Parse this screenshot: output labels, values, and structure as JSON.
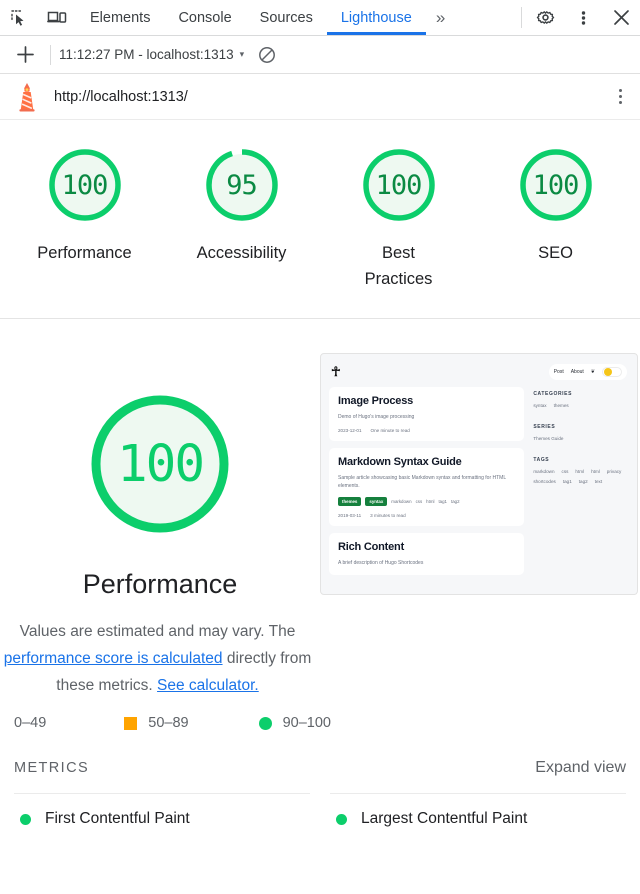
{
  "devtools": {
    "icons": {
      "inspect": "inspect-element-icon",
      "device": "device-toolbar-icon",
      "more_tabs": "»",
      "settings": "gear-icon",
      "menu": "kebab-menu-icon",
      "close": "close-icon"
    },
    "tabs": [
      {
        "label": "Elements",
        "active": false
      },
      {
        "label": "Console",
        "active": false
      },
      {
        "label": "Sources",
        "active": false
      },
      {
        "label": "Lighthouse",
        "active": true
      }
    ]
  },
  "runbar": {
    "new_report_label": "+",
    "selected_run": "11:12:27 PM - localhost:1313",
    "caret": "▾",
    "clear_label": "clear-icon"
  },
  "report": {
    "url": "http://localhost:1313/",
    "logo_name": "lighthouse-logo",
    "menu_label": "kebab-menu-icon"
  },
  "scores": [
    {
      "value": "100",
      "label": "Performance",
      "pct": 100,
      "color": "#0cce6b"
    },
    {
      "value": "95",
      "label": "Accessibility",
      "pct": 95,
      "color": "#0cce6b"
    },
    {
      "value": "100",
      "label": "Best Practices",
      "pct": 100,
      "color": "#0cce6b"
    },
    {
      "value": "100",
      "label": "SEO",
      "pct": 100,
      "color": "#0cce6b"
    }
  ],
  "performance": {
    "score": "100",
    "title": "Performance",
    "desc_part1": "Values are estimated and may vary. The ",
    "desc_link1": "performance score is calculated",
    "desc_part2": " directly from these metrics. ",
    "desc_link2": "See calculator."
  },
  "screenshot": {
    "logo": "☥",
    "nav": [
      "Post",
      "About"
    ],
    "translate_icon": "translate-icon",
    "theme_toggle": "theme-toggle",
    "cards": [
      {
        "title": "Image Process",
        "summary": "Demo of Hugo's image processing",
        "date": "2023-12-01",
        "read_time": "One minute to read",
        "badges": [],
        "tags": []
      },
      {
        "title": "Markdown Syntax Guide",
        "summary": "Sample article showcasing basic Markdown syntax and formatting for HTML elements.",
        "date": "2019-03-11",
        "read_time": "3 minutes to read",
        "badges": [
          "themes",
          "syntax"
        ],
        "tags": [
          "markdown",
          "css",
          "html",
          "tag1",
          "tag2"
        ]
      },
      {
        "title": "Rich Content",
        "summary": "A brief description of Hugo Shortcodes",
        "date": "",
        "read_time": "",
        "badges": [],
        "tags": []
      }
    ],
    "sidebar": [
      {
        "heading": "CATEGORIES",
        "values": [
          "syntax",
          "themes"
        ]
      },
      {
        "heading": "SERIES",
        "values": [
          "Themes Guide"
        ]
      },
      {
        "heading": "TAGS",
        "values": [
          "markdown",
          "css",
          "html",
          "html",
          "privacy",
          "shortcodes",
          "tag1",
          "tag2",
          "text"
        ]
      }
    ]
  },
  "scale": {
    "fail_range": "0–49",
    "average_range": "50–89",
    "pass_range": "90–100",
    "average_color": "#ffa400",
    "pass_color": "#0cce6b"
  },
  "metrics": {
    "heading": "METRICS",
    "expand_label": "Expand view",
    "items": [
      {
        "label": "First Contentful Paint",
        "status_color": "#0cce6b"
      },
      {
        "label": "Largest Contentful Paint",
        "status_color": "#0cce6b"
      }
    ]
  }
}
